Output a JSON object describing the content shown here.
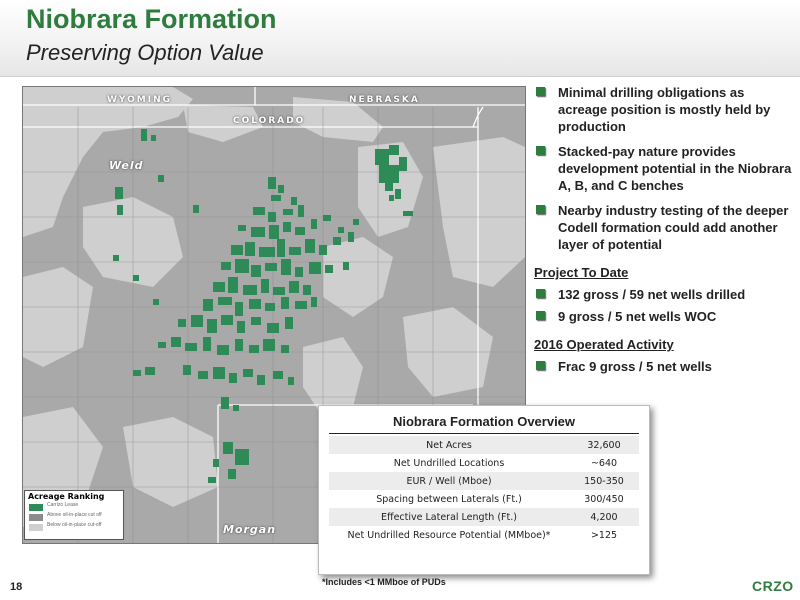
{
  "header": {
    "title": "Niobrara Formation",
    "subtitle": "Preserving Option Value"
  },
  "map": {
    "labels": {
      "wyoming": "WYOMING",
      "nebraska": "NEBRASKA",
      "colorado": "COLORADO",
      "weld": "Weld",
      "morgan": "Morgan"
    },
    "legend": {
      "title": "Acreage Ranking",
      "items": [
        {
          "label": "Carrizo Lease",
          "color": "#2e8b57"
        },
        {
          "label": "Above oil-in-place cut off",
          "color": "#8c8c8c"
        },
        {
          "label": "Below oil-in-place cut-off",
          "color": "#cfcfcf"
        }
      ]
    },
    "colors": {
      "background": "#a9a9a9",
      "light_region": "#cfcfcf",
      "lease": "#2e8b57",
      "boundary": "#ffffff"
    }
  },
  "bullets": [
    "Minimal drilling obligations as acreage position is mostly held by production",
    "Stacked-pay nature provides development potential in the Niobrara A, B, and C benches",
    "Nearby industry testing of the deeper Codell formation could add another layer of potential"
  ],
  "project_to_date": {
    "heading": "Project To Date",
    "items": [
      "132 gross / 59 net wells drilled",
      "9 gross / 5 net wells WOC"
    ]
  },
  "operated_2016": {
    "heading": "2016 Operated Activity",
    "items": [
      "Frac 9 gross / 5 net wells"
    ]
  },
  "overview": {
    "title": "Niobrara Formation Overview",
    "rows": [
      {
        "label": "Net Acres",
        "value": "32,600"
      },
      {
        "label": "Net Undrilled Locations",
        "value": "~640"
      },
      {
        "label": "EUR / Well (Mboe)",
        "value": "150-350"
      },
      {
        "label": "Spacing between Laterals (Ft.)",
        "value": "300/450"
      },
      {
        "label": "Effective Lateral Length (Ft.)",
        "value": "4,200"
      },
      {
        "label": "Net Undrilled Resource Potential (MMboe)*",
        "value": ">125"
      }
    ]
  },
  "footnote": "*Includes <1 MMboe of PUDs",
  "page_number": "18",
  "logo": "CRZO",
  "accent_color": "#2e7d3f"
}
